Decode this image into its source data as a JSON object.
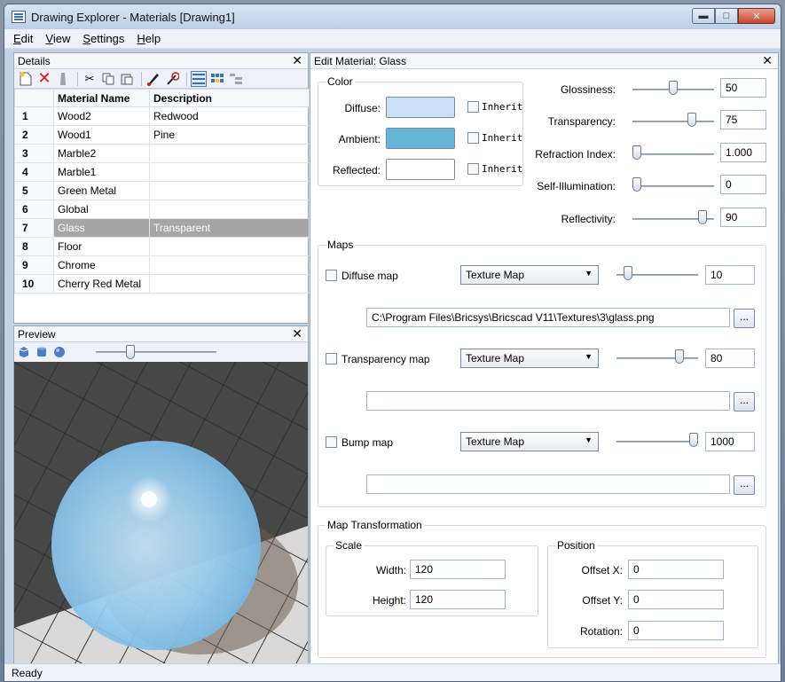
{
  "window": {
    "title": "Drawing Explorer - Materials [Drawing1]"
  },
  "menu": [
    "Edit",
    "View",
    "Settings",
    "Help"
  ],
  "details": {
    "title": "Details",
    "columns": [
      "Material Name",
      "Description"
    ],
    "rows": [
      {
        "num": "1",
        "name": "Wood2",
        "desc": "Redwood"
      },
      {
        "num": "2",
        "name": "Wood1",
        "desc": "Pine"
      },
      {
        "num": "3",
        "name": "Marble2",
        "desc": ""
      },
      {
        "num": "4",
        "name": "Marble1",
        "desc": ""
      },
      {
        "num": "5",
        "name": "Green Metal",
        "desc": ""
      },
      {
        "num": "6",
        "name": "Global",
        "desc": ""
      },
      {
        "num": "7",
        "name": "Glass",
        "desc": "Transparent",
        "selected": true
      },
      {
        "num": "8",
        "name": "Floor",
        "desc": ""
      },
      {
        "num": "9",
        "name": "Chrome",
        "desc": ""
      },
      {
        "num": "10",
        "name": "Cherry Red Metal",
        "desc": ""
      }
    ]
  },
  "preview": {
    "title": "Preview"
  },
  "edit": {
    "title": "Edit Material: Glass",
    "color": {
      "label": "Color",
      "diffuse_label": "Diffuse:",
      "ambient_label": "Ambient:",
      "reflected_label": "Reflected:",
      "inherit_label": "Inherit",
      "diffuse_color": "#c9e0f5",
      "ambient_color": "#66b4d6",
      "reflected_color": "#ffffff"
    },
    "props": [
      {
        "label": "Glossiness:",
        "value": "50",
        "level": 0.5
      },
      {
        "label": "Transparency:",
        "value": "75",
        "level": 0.75
      },
      {
        "label": "Refraction Index:",
        "value": "1.000",
        "level": 0.0
      },
      {
        "label": "Self-Illumination:",
        "value": "0",
        "level": 0.0
      },
      {
        "label": "Reflectivity:",
        "value": "90",
        "level": 0.9
      }
    ],
    "maps": {
      "label": "Maps",
      "items": [
        {
          "label": "Diffuse map",
          "type": "Texture Map",
          "value": "10",
          "level": 0.1,
          "path": "C:\\Program Files\\Bricsys\\Bricscad V11\\Textures\\3\\glass.png"
        },
        {
          "label": "Transparency map",
          "type": "Texture Map",
          "value": "80",
          "level": 0.8,
          "path": ""
        },
        {
          "label": "Bump map",
          "type": "Texture Map",
          "value": "1000",
          "level": 1.0,
          "path": ""
        }
      ],
      "browse_label": "..."
    },
    "transform": {
      "label": "Map Transformation",
      "scale_label": "Scale",
      "width_label": "Width:",
      "width": "120",
      "height_label": "Height:",
      "height": "120",
      "position_label": "Position",
      "offset_x_label": "Offset X:",
      "offset_x": "0",
      "offset_y_label": "Offset Y:",
      "offset_y": "0",
      "rotation_label": "Rotation:",
      "rotation": "0"
    }
  },
  "status": "Ready"
}
